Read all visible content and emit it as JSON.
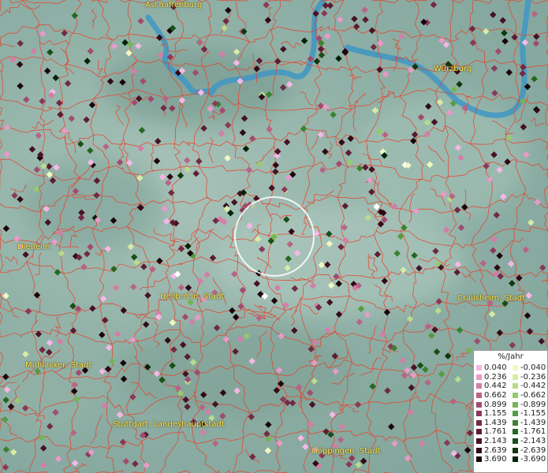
{
  "map": {
    "cities": [
      {
        "id": "aschaffenburg",
        "label": "Aschaffenburg"
      },
      {
        "id": "wurzburg",
        "label": "Würzburg"
      },
      {
        "id": "dieburg",
        "label": "Dieheim"
      },
      {
        "id": "heilbronn",
        "label": "Heilbronn, Stadt"
      },
      {
        "id": "crailsheim",
        "label": "Crailsheim, Stadt"
      },
      {
        "id": "muhlacker",
        "label": "Mühlacker, Stadt"
      },
      {
        "id": "stuttgart",
        "label": "Stuttgart, Landeshauptstadt"
      },
      {
        "id": "goppingen",
        "label": "Göppingen, Stadt"
      }
    ],
    "colors": {
      "boundary": "#e8402a",
      "river": "#3f96c4",
      "label": "#ffe64a",
      "circle": "#ffffff"
    }
  },
  "legend": {
    "title": "%/Jahr",
    "positive": [
      {
        "value": "0.040",
        "color": "#f5b8e6"
      },
      {
        "value": "0.236",
        "color": "#e89ac8"
      },
      {
        "value": "0.442",
        "color": "#d37ea8"
      },
      {
        "value": "0.662",
        "color": "#b86488"
      },
      {
        "value": "0.899",
        "color": "#a04c6e"
      },
      {
        "value": "1.155",
        "color": "#8a3a58"
      },
      {
        "value": "1.439",
        "color": "#722a44"
      },
      {
        "value": "1.761",
        "color": "#5c1c32"
      },
      {
        "value": "2.143",
        "color": "#461224"
      },
      {
        "value": "2.639",
        "color": "#300a16"
      },
      {
        "value": "3.690",
        "color": "#1a040a"
      }
    ],
    "negative": [
      {
        "value": "-0.040",
        "color": "#f0f8c0"
      },
      {
        "value": "-0.236",
        "color": "#d6eca4"
      },
      {
        "value": "-0.442",
        "color": "#b8dc8a"
      },
      {
        "value": "-0.662",
        "color": "#96ca6e"
      },
      {
        "value": "-0.899",
        "color": "#74b456"
      },
      {
        "value": "-1.155",
        "color": "#549c40"
      },
      {
        "value": "-1.439",
        "color": "#3a822e"
      },
      {
        "value": "-1.761",
        "color": "#266820"
      },
      {
        "value": "-2.143",
        "color": "#165016"
      },
      {
        "value": "-2.639",
        "color": "#0c380e"
      },
      {
        "value": "-3.690",
        "color": "#042206"
      }
    ]
  }
}
